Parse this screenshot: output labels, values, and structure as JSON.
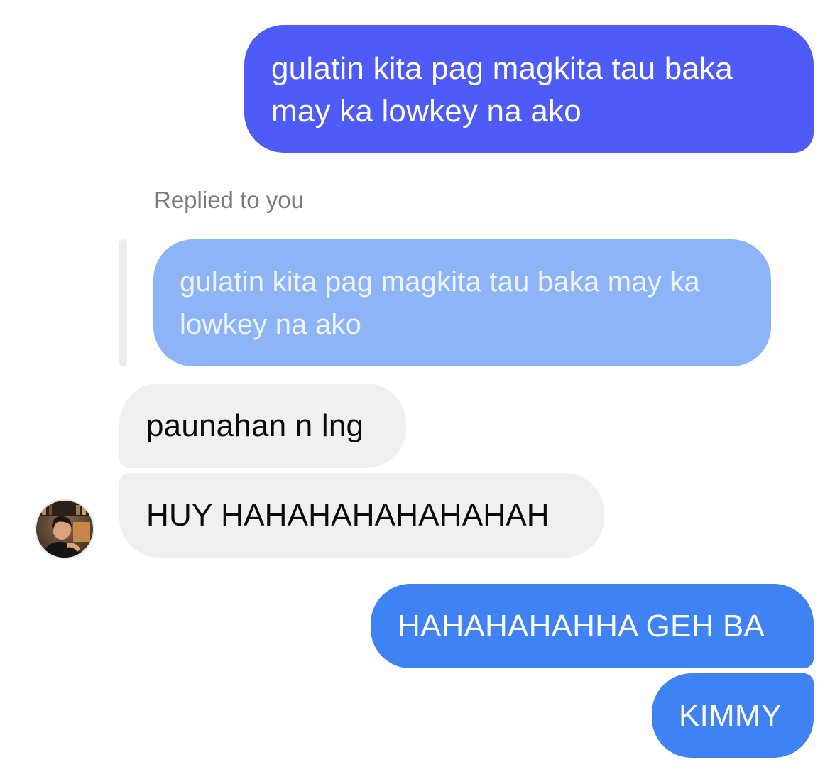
{
  "colors": {
    "sent_primary": "#4f5bf6",
    "sent_secondary": "#3e82f4",
    "quoted_bubble": "#8db4f7",
    "received_bubble": "#f0f0f0",
    "muted_text": "#7a7a7e"
  },
  "messages": [
    {
      "direction": "sent",
      "text": "gulatin kita pag magkita tau baka\nmay ka lowkey na ako"
    },
    {
      "direction": "received",
      "text": "paunahan n lng"
    },
    {
      "direction": "received",
      "text": "HUY HAHAHAHAHAHAHAH"
    },
    {
      "direction": "sent",
      "text": "HAHAHAHAHHA GEH BA"
    },
    {
      "direction": "sent",
      "text": "KIMMY"
    }
  ],
  "reply": {
    "label": "Replied to you",
    "quoted_text": "gulatin kita pag magkita tau baka may ka\nlowkey na ako"
  },
  "avatar": {
    "icon": "contact-avatar-photo"
  }
}
